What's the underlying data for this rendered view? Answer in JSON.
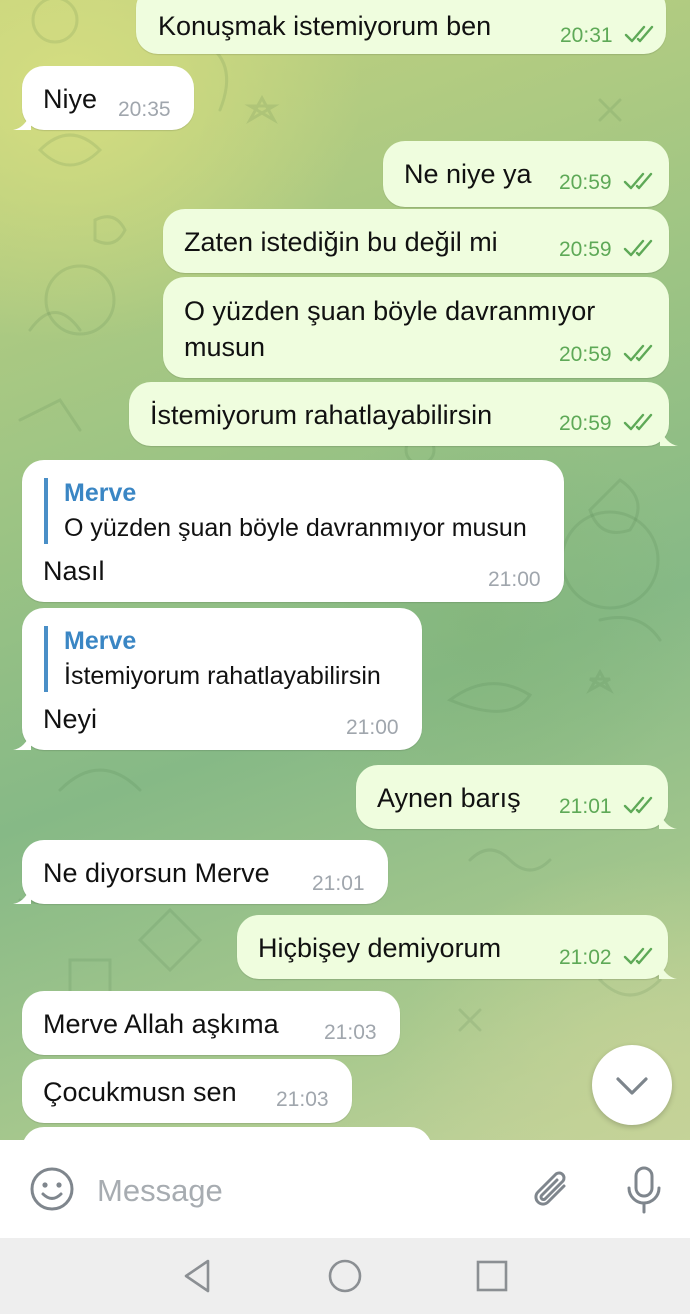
{
  "messages": [
    {
      "id": "m1",
      "direction": "out",
      "text": "Konuşmak istemiyorum ben",
      "time": "20:31",
      "read": true
    },
    {
      "id": "m2",
      "direction": "in",
      "text": "Niye",
      "time": "20:35"
    },
    {
      "id": "m3",
      "direction": "out",
      "text": "Ne niye ya",
      "time": "20:59",
      "read": true
    },
    {
      "id": "m4",
      "direction": "out",
      "text": "Zaten istediğin bu değil mi",
      "time": "20:59",
      "read": true
    },
    {
      "id": "m5",
      "direction": "out",
      "lines": [
        "O yüzden şuan böyle davranmıyor",
        "musun"
      ],
      "time": "20:59",
      "read": true
    },
    {
      "id": "m6",
      "direction": "out",
      "text": "İstemiyorum rahatlayabilirsin",
      "time": "20:59",
      "read": true
    },
    {
      "id": "m7",
      "direction": "in",
      "reply_to": {
        "name": "Merve",
        "text": "O yüzden şuan böyle davranmıyor musun"
      },
      "text": "Nasıl",
      "time": "21:00"
    },
    {
      "id": "m8",
      "direction": "in",
      "reply_to": {
        "name": "Merve",
        "text": "İstemiyorum rahatlayabilirsin"
      },
      "text": "Neyi",
      "time": "21:00"
    },
    {
      "id": "m9",
      "direction": "out",
      "text": "Aynen barış",
      "time": "21:01",
      "read": true
    },
    {
      "id": "m10",
      "direction": "in",
      "text": "Ne diyorsun Merve",
      "time": "21:01"
    },
    {
      "id": "m11",
      "direction": "out",
      "text": "Hiçbişey demiyorum",
      "time": "21:02",
      "read": true
    },
    {
      "id": "m12",
      "direction": "in",
      "text": "Merve Allah aşkıma",
      "time": "21:03"
    },
    {
      "id": "m13",
      "direction": "in",
      "text": "Çocukmusn sen",
      "time": "21:03"
    }
  ],
  "composer": {
    "placeholder": "Message",
    "emoji_icon": "smile-icon",
    "attach_icon": "paperclip-icon",
    "mic_icon": "microphone-icon"
  },
  "scroll_down_icon": "chevron-down-icon",
  "system_nav": {
    "back_icon": "back-triangle-icon",
    "home_icon": "home-circle-icon",
    "recents_icon": "recents-square-icon"
  },
  "colors": {
    "outgoing_bubble": "#effdde",
    "incoming_bubble": "#ffffff",
    "outgoing_time": "#5ea957",
    "incoming_time": "#a0a6ad",
    "reply_accent": "#3a86c4"
  }
}
